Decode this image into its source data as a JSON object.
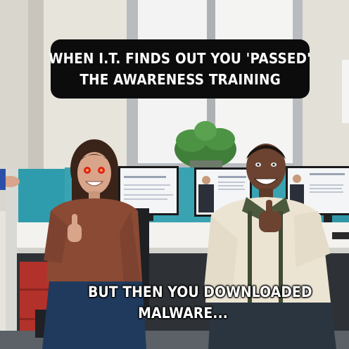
{
  "meme": {
    "top_caption": {
      "line1": "WHEN I.T. FINDS OUT YOU 'PASSED'",
      "line2": "THE AWARENESS TRAINING"
    },
    "bottom_caption": {
      "line1": "BUT THEN YOU DOWNLOADED",
      "line2": "MALWARE..."
    }
  },
  "colors": {
    "caption_bg": "#0c0c0c",
    "caption_text": "#ffffff",
    "cubicle_teal": "#2f9cad",
    "red_eyes": "#e0201a"
  }
}
